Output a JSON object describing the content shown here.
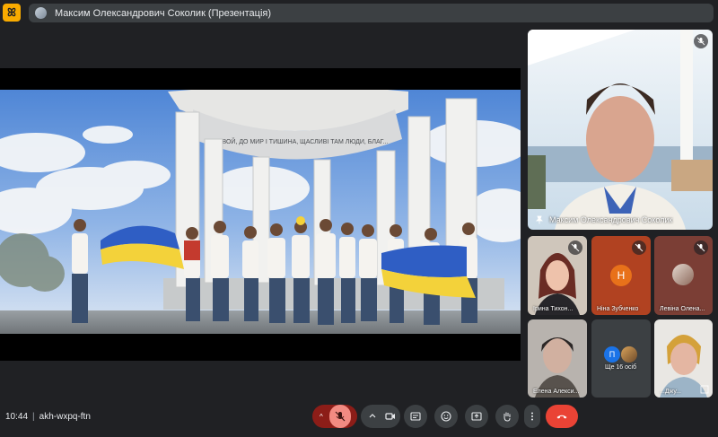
{
  "app": {
    "logo_glyph": "ꕤ"
  },
  "presentation": {
    "banner_text": "Максим Олександрович Соколик (Презентація)"
  },
  "main_video": {
    "caption_text": "...СЛАВОЙ, ДО МИР І ТИШИНА, ЩАСЛИВІ ТАМ ЛЮДИ, БЛАГ..."
  },
  "participants": {
    "featured": {
      "name": "Максим Олександрович Соколик"
    },
    "tiles": [
      {
        "name": "Ірина Тихон..."
      },
      {
        "name": "Ніна Зубченко",
        "initial": "Н",
        "color": "#e8711a"
      },
      {
        "name": "Левіна Олена..."
      },
      {
        "name": "Елена Алекси..."
      },
      {
        "name": "Ще 16 осіб",
        "initial": "П"
      },
      {
        "name": "...Джу..."
      }
    ]
  },
  "meeting": {
    "time": "10:44",
    "separator": "|",
    "code": "akh-wxpq-ftn"
  },
  "controls": {
    "raise_mic_menu": "^",
    "colors": {
      "end_call": "#ea4335",
      "mic_muted": "#8c1d18",
      "accent": "#f9ab00"
    }
  }
}
